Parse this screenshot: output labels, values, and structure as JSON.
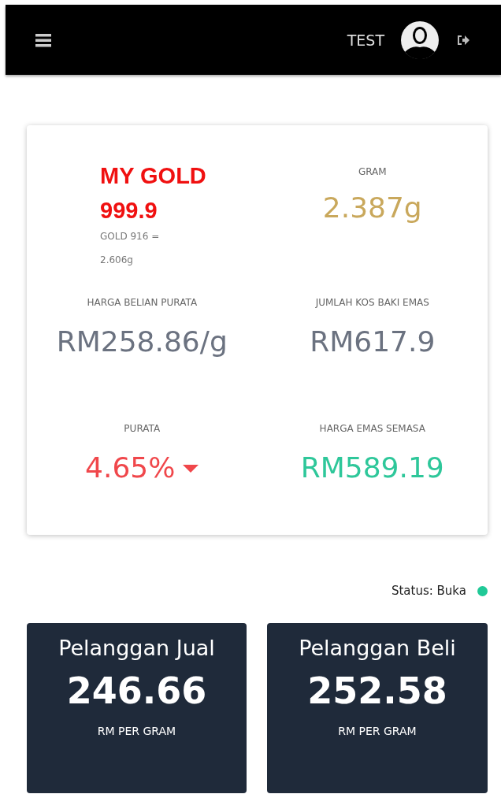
{
  "header": {
    "username": "TEST"
  },
  "summary": {
    "title": "MY GOLD 999.9",
    "subtitle": "GOLD 916 =",
    "subvalue": "2.606g",
    "stats": [
      {
        "kind": "gold",
        "label": "GRAM",
        "value": "2.387g"
      },
      {
        "kind": "neutral",
        "label": "HARGA BELIAN PURATA",
        "value": "RM258.86/g"
      },
      {
        "kind": "neutral",
        "label": "JUMLAH KOS BAKI EMAS",
        "value": "RM617.9"
      },
      {
        "kind": "negative",
        "label": "PURATA",
        "value": "4.65%",
        "falling": true
      },
      {
        "kind": "positive",
        "label": "HARGA EMAS SEMASA",
        "value": "RM589.19"
      }
    ]
  },
  "status": {
    "label": "Status: Buka",
    "color": "#20c997"
  },
  "prices": [
    {
      "title": "Pelanggan Jual",
      "value": "246.66",
      "unit": "RM PER GRAM"
    },
    {
      "title": "Pelanggan Beli",
      "value": "252.58",
      "unit": "RM PER GRAM"
    }
  ]
}
